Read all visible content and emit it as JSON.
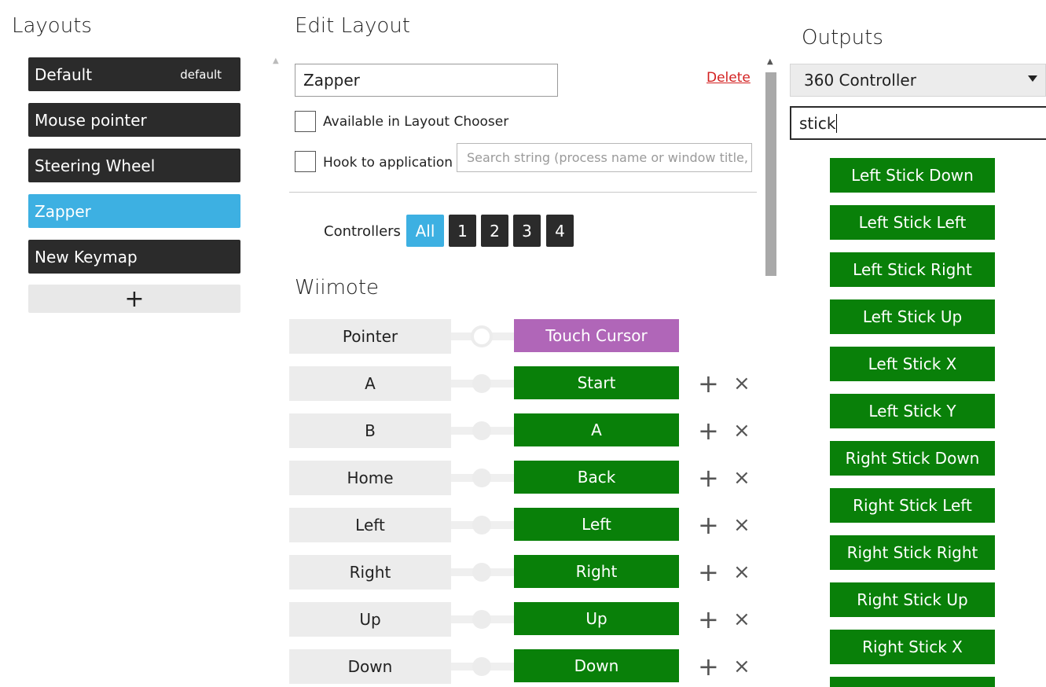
{
  "layouts": {
    "title": "Layouts",
    "items": [
      {
        "label": "Default",
        "tag": "default"
      },
      {
        "label": "Mouse pointer"
      },
      {
        "label": "Steering Wheel"
      },
      {
        "label": "Zapper",
        "selected": true
      },
      {
        "label": "New Keymap"
      }
    ],
    "add_label": "+"
  },
  "edit": {
    "title": "Edit Layout",
    "name_value": "Zapper",
    "delete_label": "Delete",
    "available_label": "Available in Layout Chooser",
    "hook_label": "Hook to application",
    "search_placeholder": "Search string (process name or window title, e",
    "controllers_label": "Controllers",
    "controller_buttons": [
      "All",
      "1",
      "2",
      "3",
      "4"
    ],
    "section_title": "Wiimote",
    "rows": [
      {
        "input": "Pointer",
        "output": "Touch Cursor"
      },
      {
        "input": "A",
        "output": "Start"
      },
      {
        "input": "B",
        "output": "A"
      },
      {
        "input": "Home",
        "output": "Back"
      },
      {
        "input": "Left",
        "output": "Left"
      },
      {
        "input": "Right",
        "output": "Right"
      },
      {
        "input": "Up",
        "output": "Up"
      },
      {
        "input": "Down",
        "output": "Down"
      }
    ],
    "row_add": "+",
    "row_remove": "×"
  },
  "outputs": {
    "title": "Outputs",
    "device_selected": "360 Controller",
    "search_value": "stick",
    "items": [
      "Left Stick Down",
      "Left Stick Left",
      "Left Stick Right",
      "Left Stick Up",
      "Left Stick X",
      "Left Stick Y",
      "Right Stick Down",
      "Right Stick Left",
      "Right Stick Right",
      "Right Stick Up",
      "Right Stick X",
      ""
    ]
  },
  "colors": {
    "accent": "#3db0e2",
    "dark": "#2b2b2b",
    "green": "#098009",
    "purple": "#b066b8",
    "delete": "#d32020"
  }
}
